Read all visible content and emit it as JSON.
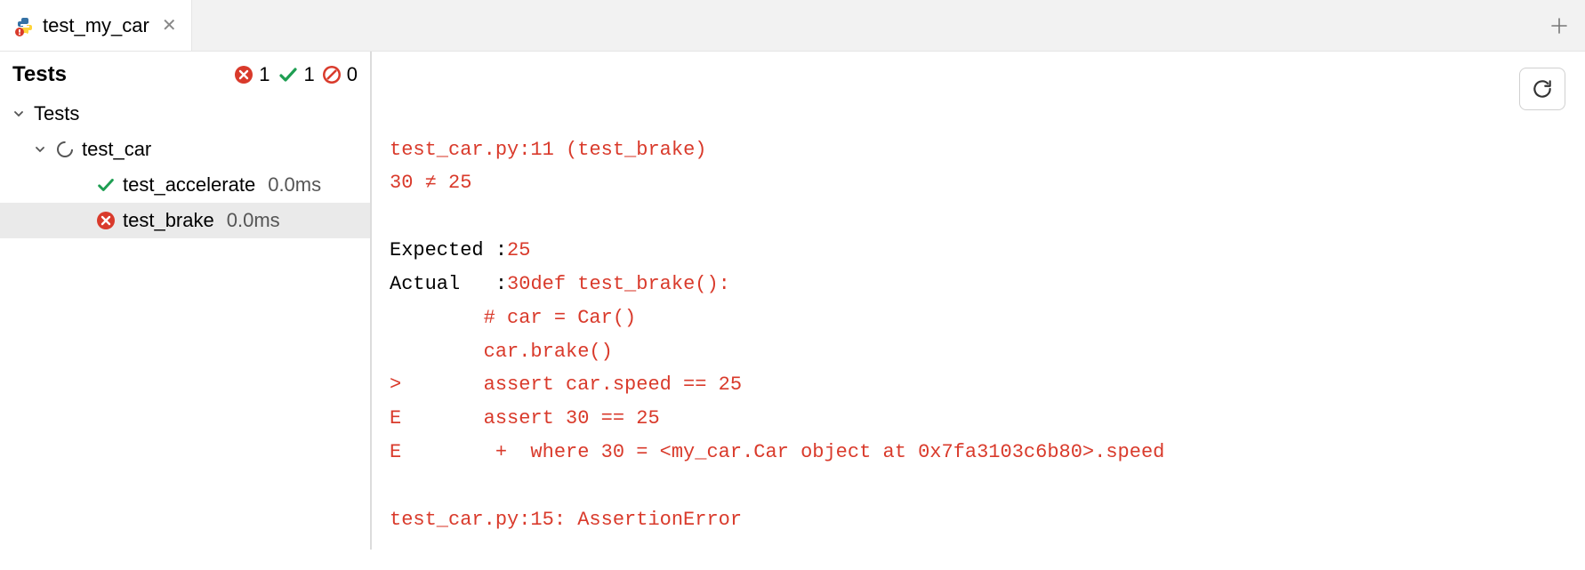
{
  "tab": {
    "filename": "test_my_car"
  },
  "left": {
    "title": "Tests",
    "stats": {
      "failed": 1,
      "passed": 1,
      "ignored": 0
    },
    "tree": {
      "root": {
        "label": "Tests"
      },
      "module": {
        "label": "test_car"
      },
      "tests": [
        {
          "name": "test_accelerate",
          "status": "passed",
          "duration": "0.0ms"
        },
        {
          "name": "test_brake",
          "status": "failed",
          "duration": "0.0ms"
        }
      ]
    }
  },
  "output": {
    "header_pre": "test_car.py",
    "header_line": ":11 (test_brake)",
    "cmp_left": "30 ",
    "cmp_op": "≠",
    "cmp_right": " 25",
    "expected_label": "Expected :",
    "expected_val": "25",
    "actual_label": "Actual   :",
    "actual_val": "30",
    "code_def": "def test_brake():",
    "code_l2": "        # car = Car()",
    "code_l3": "        car.brake()",
    "code_l4": ">       assert car.speed == 25",
    "code_l5": "E       assert 30 == 25",
    "code_l6": "E        +  where 30 = <my_car.Car object at 0x7fa3103c6b80>.speed",
    "footer": "test_car.py:15: AssertionError"
  }
}
